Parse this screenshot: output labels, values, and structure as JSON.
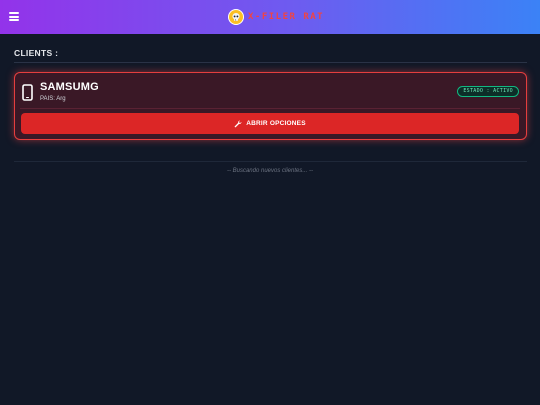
{
  "header": {
    "title": "X-FILER RAT",
    "menu_icon": "hamburger-menu-icon",
    "logo_icon": "skull-icon"
  },
  "clients_section": {
    "title": "CLIENTS :",
    "clients": [
      {
        "name": "SAMSUMG",
        "country": "PAIS: Arg",
        "status": "ESTADO : ACTIVO",
        "device_icon": "smartphone-icon",
        "action_label": "ABRIR OPCIONES",
        "action_icon": "wrench-icon"
      }
    ]
  },
  "status_text": "-- Buscando nuevos clientes... --",
  "colors": {
    "header_gradient_start": "#9333ea",
    "header_gradient_end": "#3b82f6",
    "accent_red": "#dc2626",
    "status_green": "#10b981",
    "background": "#111827"
  }
}
